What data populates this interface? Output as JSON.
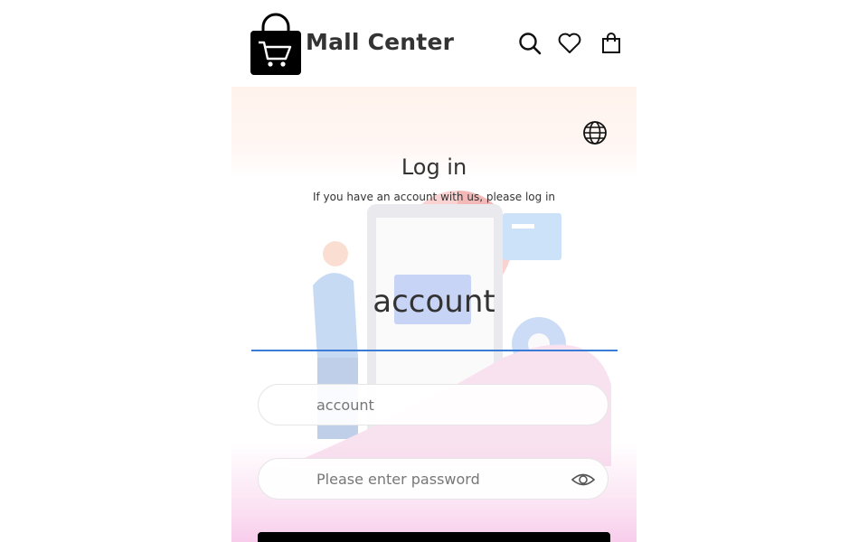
{
  "header": {
    "brand": "Mall Center",
    "icons": [
      "shopping-bag-cart-logo",
      "search-icon",
      "heart-icon",
      "bag-icon"
    ]
  },
  "login": {
    "title": "Log in",
    "subtitle": "If you have an account with us, please log in",
    "active_tab": "account",
    "account_field": {
      "value": "",
      "placeholder": "account"
    },
    "password_field": {
      "value": "",
      "placeholder": "Please enter password"
    },
    "login_button_label": ""
  },
  "colors": {
    "accent": "#3a7bd5",
    "brand_text": "#333333",
    "button": "#000000",
    "hero_bottom": "#f8cdeb"
  }
}
